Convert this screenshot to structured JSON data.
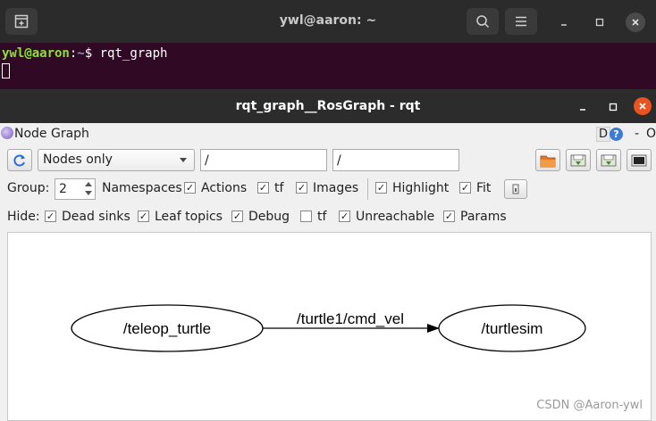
{
  "terminal": {
    "title": "ywl@aaron: ~",
    "prompt_user": "ywl@aaron",
    "prompt_sep": ":",
    "prompt_path": "~",
    "prompt_dollar": "$",
    "command": "rqt_graph"
  },
  "rqt": {
    "title": "rqt_graph__RosGraph - rqt",
    "plugin_name": "Node Graph",
    "plugin_d": "D",
    "plugin_help": "?",
    "plugin_dash": "-",
    "plugin_o": "O",
    "view_mode": "Nodes only",
    "filter_1": "/",
    "filter_2": "/",
    "group_label": "Group:",
    "group_value": "2",
    "options": {
      "namespaces": "Namespaces",
      "actions": "Actions",
      "tf": "tf",
      "images": "Images",
      "highlight": "Highlight",
      "fit": "Fit"
    },
    "hide_label": "Hide:",
    "hide": {
      "dead_sinks": "Dead sinks",
      "leaf_topics": "Leaf topics",
      "debug": "Debug",
      "tf": "tf",
      "unreachable": "Unreachable",
      "params": "Params"
    },
    "checkmark": "✓",
    "graph": {
      "node_1": "/teleop_turtle",
      "node_2": "/turtlesim",
      "edge_label": "/turtle1/cmd_vel"
    }
  },
  "watermark": "CSDN @Aaron-ywl"
}
